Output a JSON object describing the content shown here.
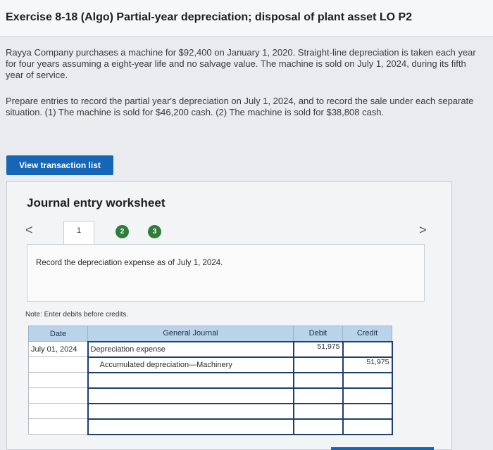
{
  "header": {
    "title": "Exercise 8-18 (Algo) Partial-year depreciation; disposal of plant asset LO P2"
  },
  "problem": {
    "paragraph1": "Rayya Company purchases a machine for $92,400 on January 1, 2020. Straight-line depreciation is taken each year for four years assuming a eight-year life and no salvage value. The machine is sold on July 1, 2024, during its fifth year of service.",
    "paragraph2": "Prepare entries to record the partial year's depreciation on July 1, 2024, and to record the sale under each separate situation. (1) The machine is sold for $46,200 cash. (2) The machine is sold for $38,808 cash."
  },
  "buttons": {
    "view_transactions": "View transaction list"
  },
  "worksheet": {
    "title": "Journal entry worksheet",
    "nav_prev": "<",
    "nav_next": ">",
    "tabs": [
      "1",
      "2",
      "3"
    ],
    "instruction": "Record the depreciation expense as of July 1, 2024.",
    "note": "Note: Enter debits before credits.",
    "columns": {
      "date": "Date",
      "general_journal": "General Journal",
      "debit": "Debit",
      "credit": "Credit"
    },
    "rows": [
      {
        "date": "July 01, 2024",
        "account": "Depreciation expense",
        "debit": "51,975",
        "credit": ""
      },
      {
        "date": "",
        "account": "Accumulated depreciation—Machinery",
        "debit": "",
        "credit": "51,975"
      },
      {
        "date": "",
        "account": "",
        "debit": "",
        "credit": ""
      },
      {
        "date": "",
        "account": "",
        "debit": "",
        "credit": ""
      },
      {
        "date": "",
        "account": "",
        "debit": "",
        "credit": ""
      },
      {
        "date": "",
        "account": "",
        "debit": "",
        "credit": ""
      }
    ]
  },
  "colors": {
    "accent": "#1566b6",
    "tab_complete": "#2f7d3a",
    "table_header": "#b9d3ea"
  },
  "icons": {
    "prev": "chevron-left-icon",
    "next": "chevron-right-icon"
  }
}
